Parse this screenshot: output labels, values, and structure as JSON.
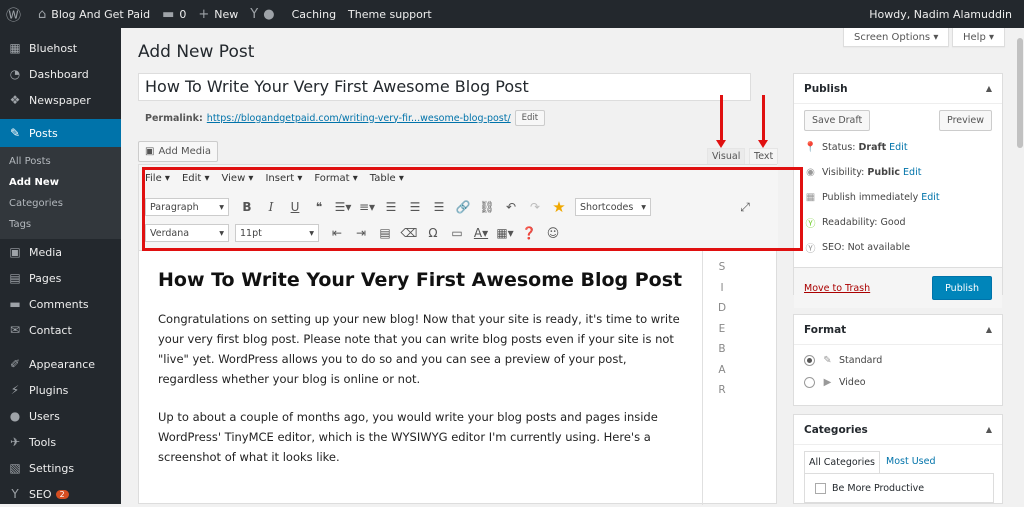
{
  "adminbar": {
    "wp_logo": "wordpress-icon",
    "site_name": "Blog And Get Paid",
    "comments": "0",
    "new": "New",
    "caching": "Caching",
    "theme_support": "Theme support",
    "greeting": "Howdy, Nadim Alamuddin"
  },
  "sidebar": {
    "items": [
      {
        "label": "Bluehost",
        "icon": "grid-icon"
      },
      {
        "label": "Dashboard",
        "icon": "gauge-icon"
      },
      {
        "label": "Newspaper",
        "icon": "newspaper-icon"
      },
      {
        "label": "Posts",
        "icon": "pin-icon"
      },
      {
        "label": "Media",
        "icon": "media-icon"
      },
      {
        "label": "Pages",
        "icon": "pages-icon"
      },
      {
        "label": "Comments",
        "icon": "comment-icon"
      },
      {
        "label": "Contact",
        "icon": "mail-icon"
      },
      {
        "label": "Appearance",
        "icon": "brush-icon"
      },
      {
        "label": "Plugins",
        "icon": "plug-icon"
      },
      {
        "label": "Users",
        "icon": "user-icon"
      },
      {
        "label": "Tools",
        "icon": "wrench-icon"
      },
      {
        "label": "Settings",
        "icon": "settings-icon"
      },
      {
        "label": "SEO",
        "icon": "seo-icon"
      }
    ],
    "posts_sub": [
      "All Posts",
      "Add New",
      "Categories",
      "Tags"
    ],
    "seo_badge": "2"
  },
  "header": {
    "title": "Add New Post",
    "screen_options": "Screen Options ▾",
    "help": "Help ▾"
  },
  "editor": {
    "post_title": "How To Write Your Very First Awesome Blog Post",
    "permalink_label": "Permalink:",
    "permalink_url": "https://blogandgetpaid.com/writing-very-fir...wesome-blog-post/",
    "edit": "Edit",
    "add_media": "Add Media",
    "tab_visual": "Visual",
    "tab_text": "Text",
    "menus": [
      "File ▾",
      "Edit ▾",
      "View ▾",
      "Insert ▾",
      "Format ▾",
      "Table ▾"
    ],
    "paragraph": "Paragraph",
    "shortcodes": "Shortcodes",
    "font": "Verdana",
    "size": "11pt",
    "heading": "How To Write Your Very First Awesome Blog Post",
    "p1": "Congratulations on setting up your new blog! Now that your site is ready, it's time to write your very first blog post. Please note that you can write blog posts even if your site is not \"live\" yet. WordPress allows you to do so and you can see a preview of your post, regardless whether your blog is online or not.",
    "p2": "Up to about a couple of months ago, you would write your blog posts and pages inside WordPress' TinyMCE editor, which is the WYSIWYG editor I'm currently using. Here's a screenshot of what it looks like.",
    "sidebar_letters": [
      "S",
      "I",
      "D",
      "E",
      "B",
      "A",
      "R"
    ]
  },
  "publish": {
    "title": "Publish",
    "save_draft": "Save Draft",
    "preview": "Preview",
    "status_label": "Status:",
    "status": "Draft",
    "visibility_label": "Visibility:",
    "visibility": "Public",
    "schedule": "Publish immediately",
    "readability": "Readability: Good",
    "seo": "SEO: Not available",
    "trash": "Move to Trash",
    "publish_btn": "Publish",
    "edit": "Edit"
  },
  "format": {
    "title": "Format",
    "standard": "Standard",
    "video": "Video"
  },
  "categories": {
    "title": "Categories",
    "all": "All Categories",
    "most_used": "Most Used",
    "item": "Be More Productive"
  }
}
